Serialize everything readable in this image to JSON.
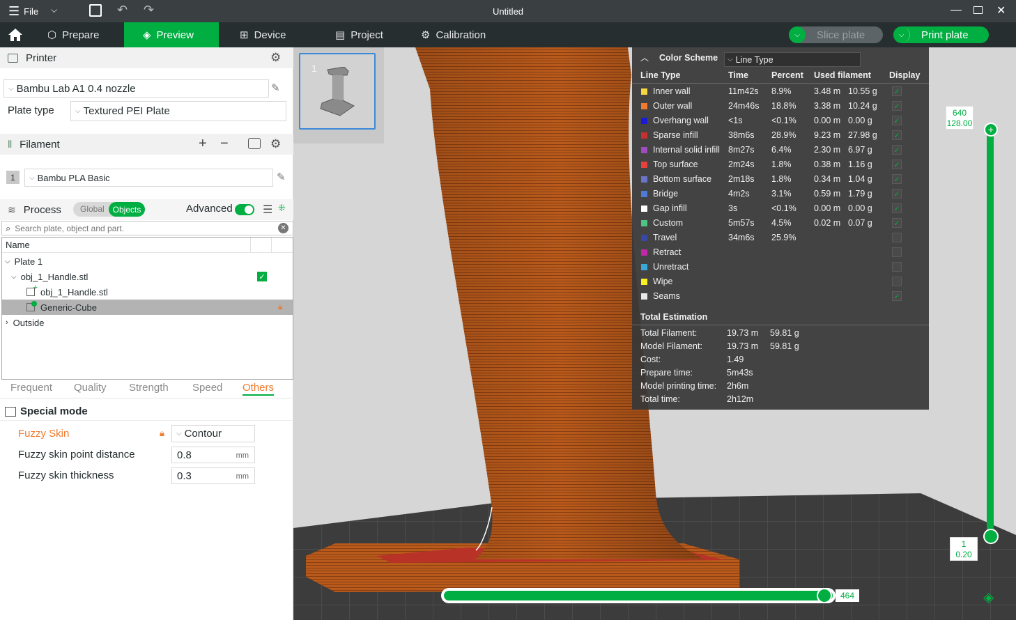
{
  "titlebar": {
    "menu_label": "File",
    "title": "Untitled"
  },
  "tabs": [
    {
      "label": "Prepare"
    },
    {
      "label": "Preview"
    },
    {
      "label": "Device"
    },
    {
      "label": "Project"
    },
    {
      "label": "Calibration"
    }
  ],
  "actions": {
    "slice": "Slice plate",
    "print": "Print plate"
  },
  "printer": {
    "section": "Printer",
    "model": "Bambu Lab A1 0.4 nozzle",
    "plate_type_label": "Plate type",
    "plate_type": "Textured PEI Plate"
  },
  "filament": {
    "section": "Filament",
    "slot": "1",
    "name": "Bambu PLA Basic"
  },
  "process": {
    "section": "Process",
    "global": "Global",
    "objects": "Objects",
    "advanced": "Advanced",
    "search_placeholder": "Search plate, object and part."
  },
  "tree": {
    "header": "Name",
    "items": [
      "Plate 1",
      "obj_1_Handle.stl",
      "obj_1_Handle.stl",
      "Generic-Cube",
      "Outside"
    ]
  },
  "setting_tabs": [
    "Frequent",
    "Quality",
    "Strength",
    "Speed",
    "Others"
  ],
  "special": {
    "title": "Special mode",
    "fuzzy_label": "Fuzzy Skin",
    "fuzzy_value": "Contour",
    "dist_label": "Fuzzy skin point distance",
    "dist_value": "0.8",
    "dist_unit": "mm",
    "thick_label": "Fuzzy skin thickness",
    "thick_value": "0.3",
    "thick_unit": "mm"
  },
  "thumb": {
    "index": "1"
  },
  "legend": {
    "title": "Color Scheme",
    "scheme": "Line Type",
    "headers": [
      "Line Type",
      "Time",
      "Percent",
      "Used filament",
      "Display"
    ],
    "rows": [
      {
        "name": "Inner wall",
        "color": "#f5d742",
        "time": "11m42s",
        "pct": "8.9%",
        "m": "3.48 m",
        "g": "10.55 g",
        "on": true
      },
      {
        "name": "Outer wall",
        "color": "#f07a2e",
        "time": "24m46s",
        "pct": "18.8%",
        "m": "3.38 m",
        "g": "10.24 g",
        "on": true
      },
      {
        "name": "Overhang wall",
        "color": "#1a1ad8",
        "time": "<1s",
        "pct": "<0.1%",
        "m": "0.00 m",
        "g": "0.00 g",
        "on": true
      },
      {
        "name": "Sparse infill",
        "color": "#c8302e",
        "time": "38m6s",
        "pct": "28.9%",
        "m": "9.23 m",
        "g": "27.98 g",
        "on": true
      },
      {
        "name": "Internal solid infill",
        "color": "#a04bc0",
        "time": "8m27s",
        "pct": "6.4%",
        "m": "2.30 m",
        "g": "6.97 g",
        "on": true
      },
      {
        "name": "Top surface",
        "color": "#e8403a",
        "time": "2m24s",
        "pct": "1.8%",
        "m": "0.38 m",
        "g": "1.16 g",
        "on": true
      },
      {
        "name": "Bottom surface",
        "color": "#6a74c8",
        "time": "2m18s",
        "pct": "1.8%",
        "m": "0.34 m",
        "g": "1.04 g",
        "on": true
      },
      {
        "name": "Bridge",
        "color": "#4f7ad8",
        "time": "4m2s",
        "pct": "3.1%",
        "m": "0.59 m",
        "g": "1.79 g",
        "on": true
      },
      {
        "name": "Gap infill",
        "color": "#ffffff",
        "time": "3s",
        "pct": "<0.1%",
        "m": "0.00 m",
        "g": "0.00 g",
        "on": true
      },
      {
        "name": "Custom",
        "color": "#4cc486",
        "time": "5m57s",
        "pct": "4.5%",
        "m": "0.02 m",
        "g": "0.07 g",
        "on": true
      },
      {
        "name": "Travel",
        "color": "#3848a8",
        "time": "34m6s",
        "pct": "25.9%",
        "m": "",
        "g": "",
        "on": false
      },
      {
        "name": "Retract",
        "color": "#c028a8",
        "time": "",
        "pct": "",
        "m": "",
        "g": "",
        "on": false
      },
      {
        "name": "Unretract",
        "color": "#38a8d8",
        "time": "",
        "pct": "",
        "m": "",
        "g": "",
        "on": false
      },
      {
        "name": "Wipe",
        "color": "#f8f020",
        "time": "",
        "pct": "",
        "m": "",
        "g": "",
        "on": false
      },
      {
        "name": "Seams",
        "color": "#e8e8e8",
        "time": "",
        "pct": "",
        "m": "",
        "g": "",
        "on": true
      }
    ],
    "total_title": "Total Estimation",
    "totals": [
      {
        "label": "Total Filament:",
        "v1": "19.73 m",
        "v2": "59.81 g"
      },
      {
        "label": "Model Filament:",
        "v1": "19.73 m",
        "v2": "59.81 g"
      },
      {
        "label": "Cost:",
        "v1": "1.49",
        "v2": ""
      },
      {
        "label": "Prepare time:",
        "v1": "5m43s",
        "v2": ""
      },
      {
        "label": "Model printing time:",
        "v1": "2h6m",
        "v2": ""
      },
      {
        "label": "Total time:",
        "v1": "2h12m",
        "v2": ""
      }
    ]
  },
  "layer_slider": {
    "top_layer": "640",
    "top_height": "128.00",
    "bottom_layer": "1",
    "bottom_height": "0.20"
  },
  "move_slider": {
    "value": "464"
  },
  "colors": {
    "accent": "#00ae42",
    "dark": "#262e30",
    "orange": "#f07a2e",
    "filament": "#b85a1c"
  }
}
